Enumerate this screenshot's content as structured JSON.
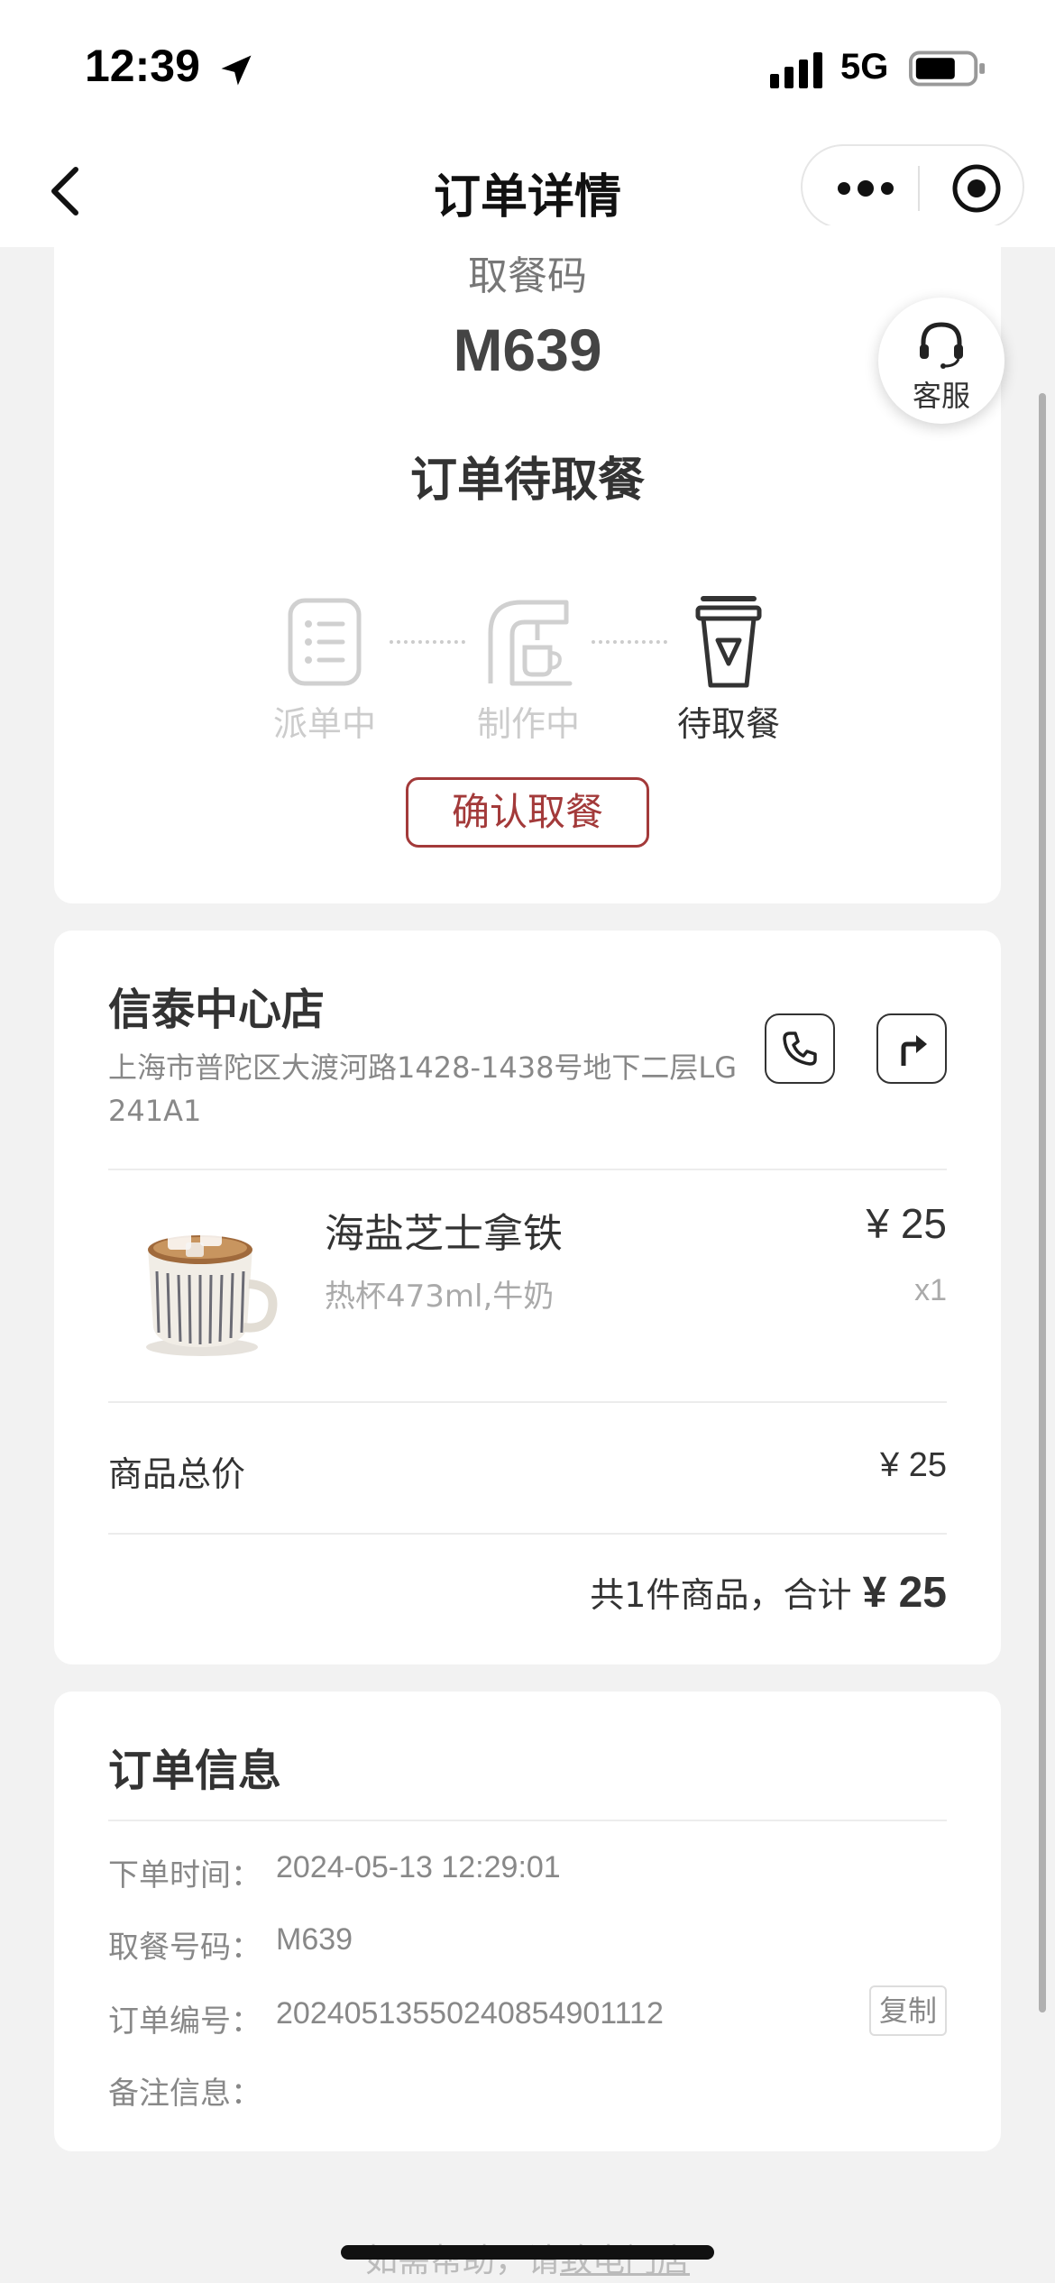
{
  "status_bar": {
    "time": "12:39",
    "network": "5G",
    "icons": [
      "location-arrow-icon",
      "signal-icon",
      "battery-icon"
    ]
  },
  "nav": {
    "title": "订单详情",
    "icons": [
      "chevron-left-icon",
      "more-dots-icon",
      "target-icon"
    ]
  },
  "pickup": {
    "label": "取餐码",
    "code": "M639",
    "status": "订单待取餐",
    "steps": [
      {
        "label": "派单中",
        "icon": "order-list-icon",
        "active": false
      },
      {
        "label": "制作中",
        "icon": "coffee-machine-icon",
        "active": false
      },
      {
        "label": "待取餐",
        "icon": "cup-icon",
        "active": true
      }
    ],
    "confirm_label": "确认取餐"
  },
  "service": {
    "label": "客服",
    "icon": "headset-icon"
  },
  "store": {
    "name": "信泰中心店",
    "address": "上海市普陀区大渡河路1428-1438号地下二层LG241A1",
    "actions": [
      "phone-icon",
      "navigation-icon"
    ]
  },
  "product": {
    "name": "海盐芝士拿铁",
    "spec": "热杯473ml,牛奶",
    "price": "¥ 25",
    "qty": "x1"
  },
  "summary": {
    "subtotal_label": "商品总价",
    "subtotal_value": "¥ 25",
    "total_prefix": "共1件商品，合计",
    "total_amount": "¥ 25"
  },
  "order_info": {
    "title": "订单信息",
    "rows": [
      {
        "key": "下单时间：",
        "value": "2024-05-13 12:29:01"
      },
      {
        "key": "取餐号码：",
        "value": "M639"
      },
      {
        "key": "订单编号：",
        "value": "20240513550240854901112"
      },
      {
        "key": "备注信息：",
        "value": ""
      }
    ],
    "copy_label": "复制"
  },
  "footer": {
    "help_prefix": "如需帮助，请",
    "help_link": "致电门店"
  },
  "colors": {
    "accent": "#a33a3a",
    "page_bg": "#f2f2f2",
    "inactive": "#cccccc"
  }
}
